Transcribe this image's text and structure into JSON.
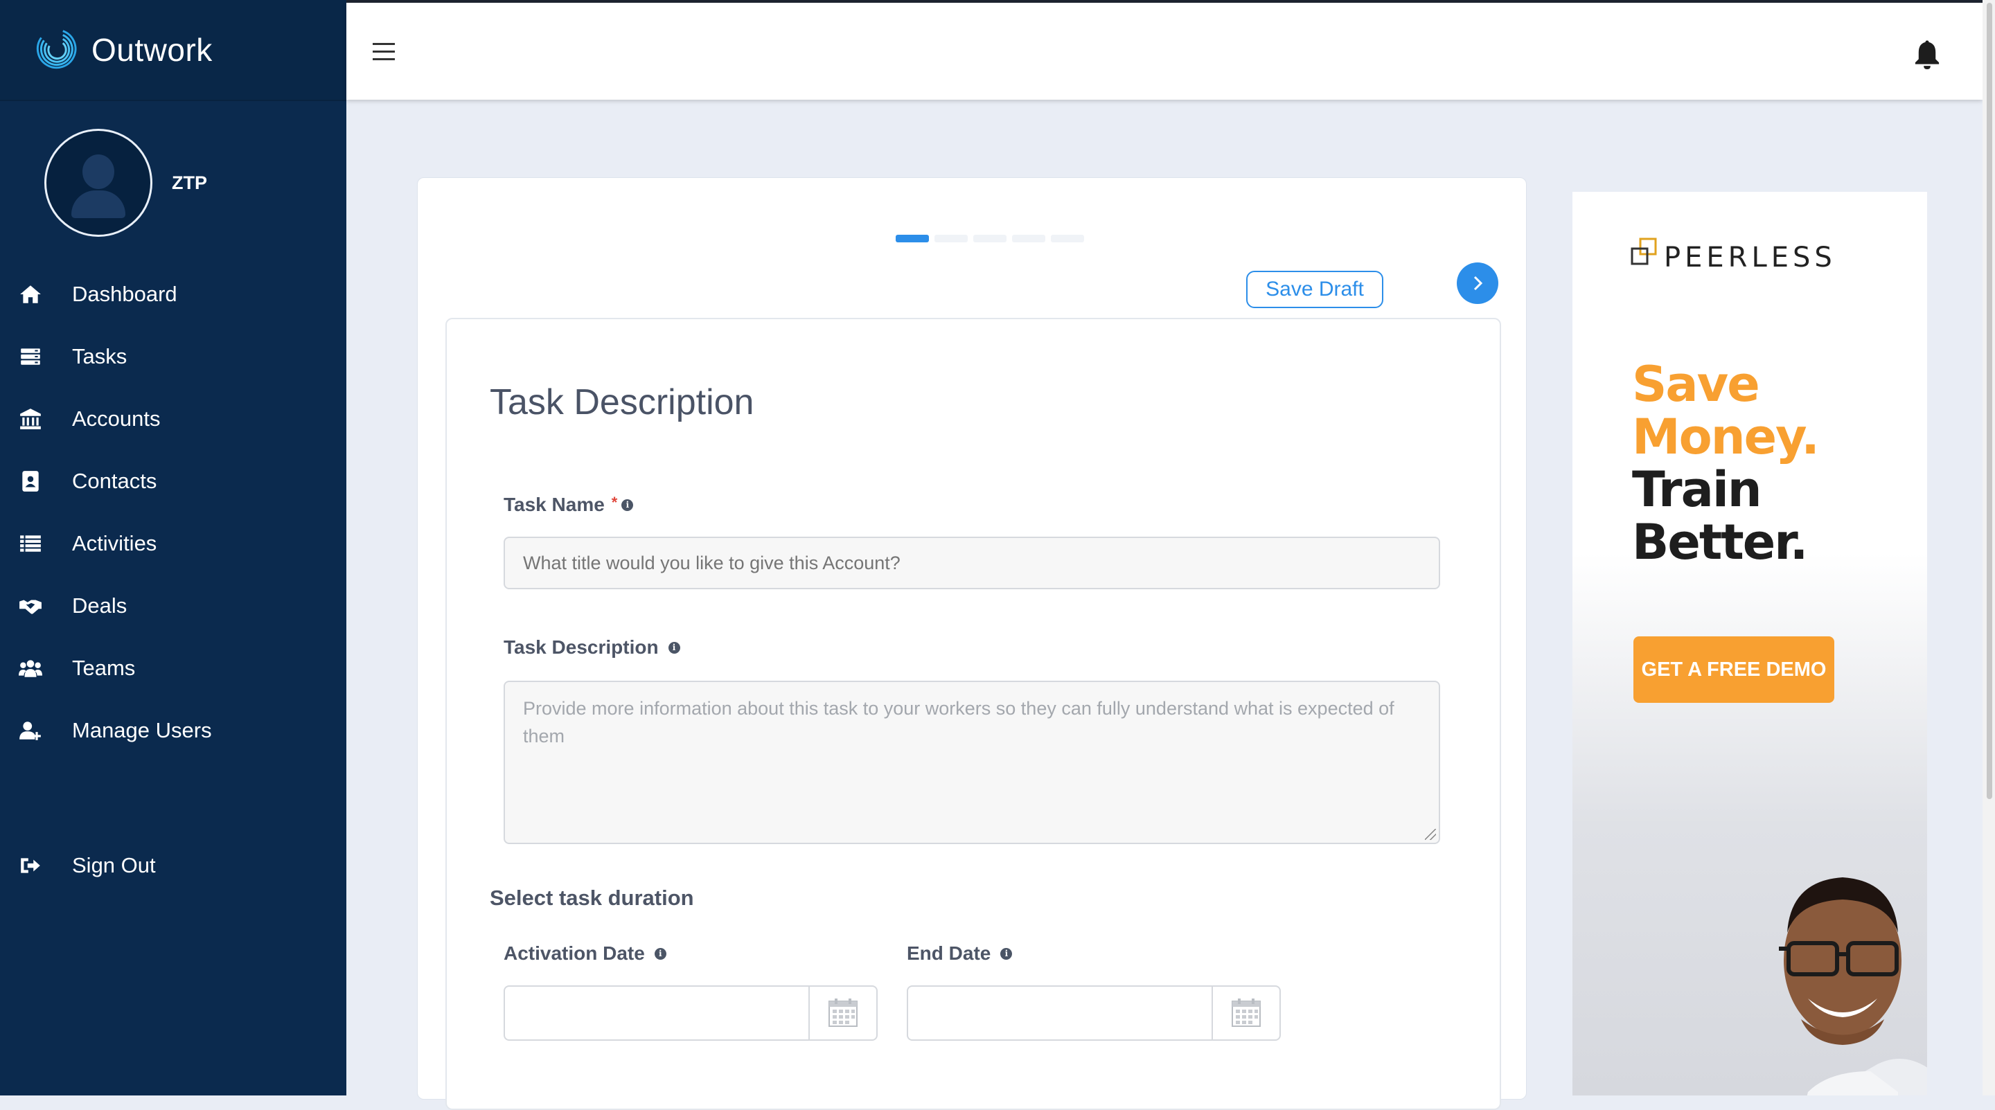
{
  "app": {
    "name": "Outwork"
  },
  "profile": {
    "name": "ZTP"
  },
  "sidebar": {
    "items": [
      {
        "label": "Dashboard",
        "icon": "home-icon"
      },
      {
        "label": "Tasks",
        "icon": "tasks-icon"
      },
      {
        "label": "Accounts",
        "icon": "bank-icon"
      },
      {
        "label": "Contacts",
        "icon": "contact-book-icon"
      },
      {
        "label": "Activities",
        "icon": "list-icon"
      },
      {
        "label": "Deals",
        "icon": "handshake-icon"
      },
      {
        "label": "Teams",
        "icon": "users-icon"
      },
      {
        "label": "Manage Users",
        "icon": "user-plus-icon"
      }
    ],
    "signout": {
      "label": "Sign Out",
      "icon": "sign-out-icon"
    }
  },
  "topbar": {
    "menu_icon": "hamburger-icon",
    "notification_icon": "bell-icon"
  },
  "wizard": {
    "steps_total": 5,
    "active_step": 1,
    "save_draft_label": "Save Draft",
    "next_icon": "chevron-right-icon"
  },
  "form": {
    "title": "Task Description",
    "task_name": {
      "label": "Task Name",
      "required_mark": "*",
      "placeholder": "What title would you like to give this Account?"
    },
    "task_description": {
      "label": "Task Description",
      "placeholder": "Provide more information about this task to your workers so they can fully understand what is expected of them"
    },
    "duration": {
      "section_label": "Select task duration",
      "activation_label": "Activation Date",
      "end_label": "End Date"
    }
  },
  "ad": {
    "brand": "PEERLESS",
    "headline_line1": "Save",
    "headline_line2": "Money.",
    "headline_line3": "Train",
    "headline_line4": "Better.",
    "cta": "GET A FREE DEMO",
    "accent_color": "#f8a031"
  },
  "colors": {
    "sidebar_bg": "#0b2a4e",
    "primary": "#2c8ee9",
    "page_bg": "#e9edf5"
  }
}
